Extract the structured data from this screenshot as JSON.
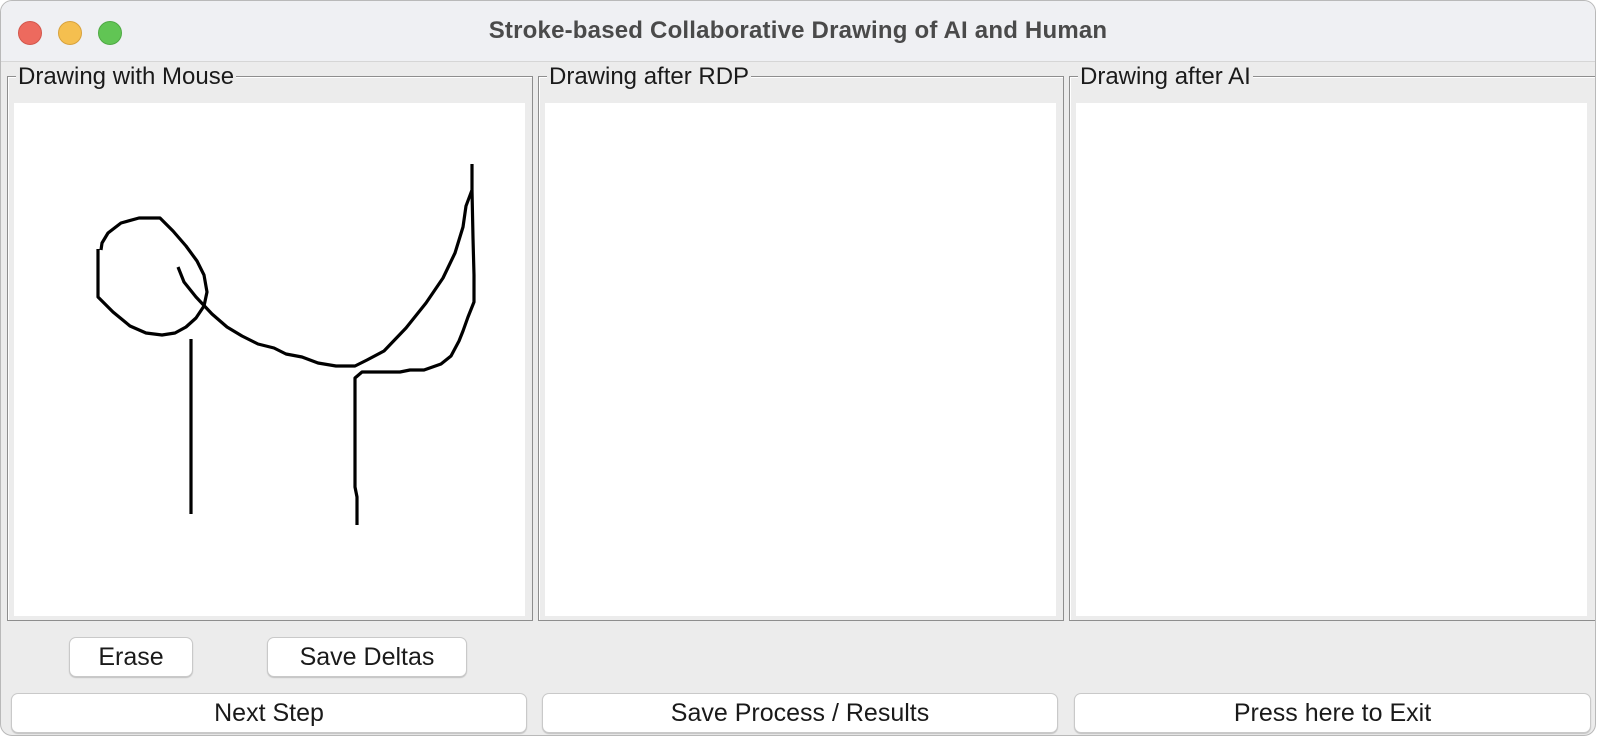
{
  "window": {
    "title": "Stroke-based Collaborative Drawing of AI and Human"
  },
  "panels": {
    "mouse": {
      "label": "Drawing with Mouse"
    },
    "rdp": {
      "label": "Drawing after RDP"
    },
    "ai": {
      "label": "Drawing after AI"
    }
  },
  "buttons": {
    "erase": "Erase",
    "save_deltas": "Save Deltas",
    "next_step": "Next Step",
    "save_process": "Save Process / Results",
    "exit": "Press here to Exit"
  },
  "colors": {
    "window_bg": "#ececec",
    "canvas_bg": "#ffffff",
    "stroke": "#000000",
    "close": "#ed6a5e",
    "minimize": "#f5bf4f",
    "maximize": "#61c554"
  }
}
